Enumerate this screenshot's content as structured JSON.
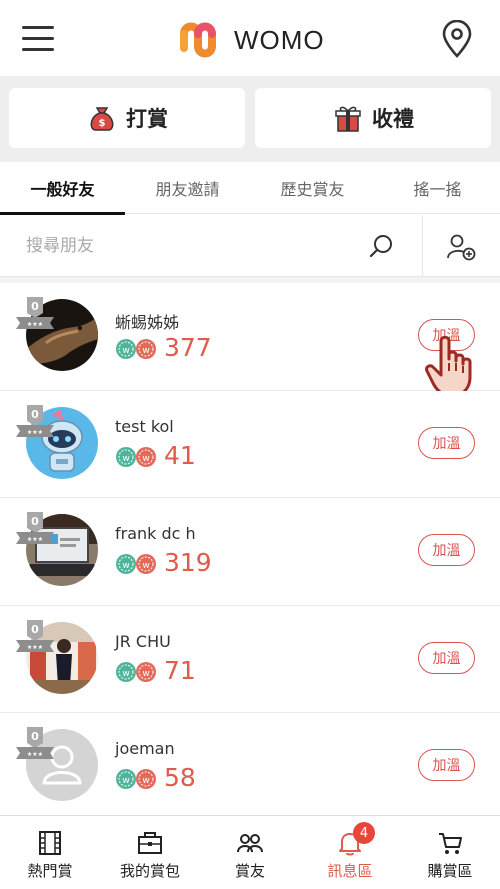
{
  "header": {
    "logo_text": "WOMO",
    "menu_icon": "hamburger-menu-icon",
    "location_icon": "map-pin-icon"
  },
  "actions": {
    "tip_label": "打賞",
    "gift_label": "收禮"
  },
  "tabs": [
    {
      "label": "一般好友",
      "active": true
    },
    {
      "label": "朋友邀請",
      "active": false
    },
    {
      "label": "歷史賞友",
      "active": false
    },
    {
      "label": "搖一搖",
      "active": false
    }
  ],
  "search": {
    "placeholder": "搜尋朋友"
  },
  "friends": [
    {
      "level": "0",
      "name": "蜥蜴姊姊",
      "score": "377",
      "button": "加溫"
    },
    {
      "level": "0",
      "name": "test kol",
      "score": "41",
      "button": "加溫"
    },
    {
      "level": "0",
      "name": "frank dc h",
      "score": "319",
      "button": "加溫"
    },
    {
      "level": "0",
      "name": "JR CHU",
      "score": "71",
      "button": "加溫"
    },
    {
      "level": "0",
      "name": "joeman",
      "score": "58",
      "button": "加溫"
    }
  ],
  "bottom_nav": [
    {
      "label": "熱門賞",
      "icon": "film-icon"
    },
    {
      "label": "我的賞包",
      "icon": "wallet-icon"
    },
    {
      "label": "賞友",
      "icon": "friends-icon"
    },
    {
      "label": "訊息區",
      "icon": "bell-icon",
      "badge": "4",
      "active": true
    },
    {
      "label": "購賞區",
      "icon": "cart-icon"
    }
  ],
  "colors": {
    "accent": "#e05b4b",
    "coin_green": "#4fb59a",
    "coin_red": "#e26a5a"
  }
}
